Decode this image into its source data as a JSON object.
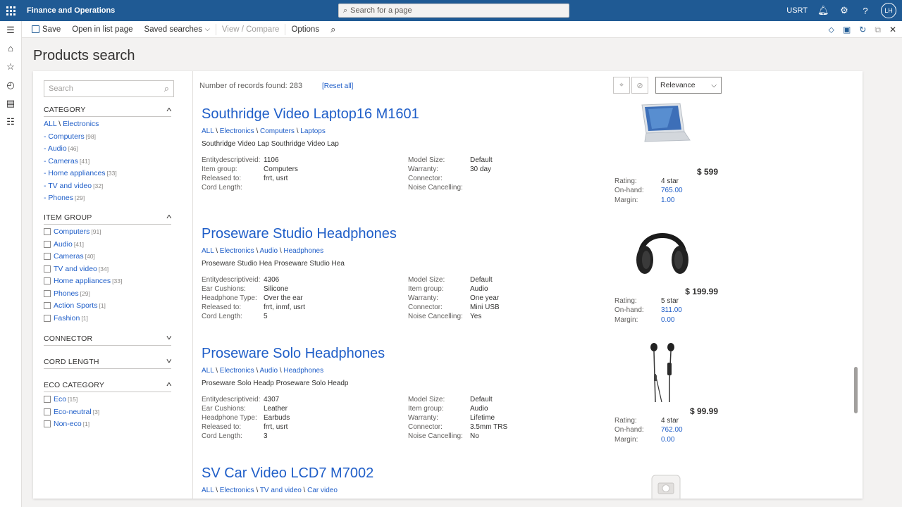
{
  "app": {
    "title": "Finance and Operations",
    "search_placeholder": "Search for a page",
    "company": "USRT",
    "user_initials": "LH"
  },
  "actions": {
    "save": "Save",
    "open_list": "Open in list page",
    "saved_searches": "Saved searches",
    "view_compare": "View / Compare",
    "options": "Options"
  },
  "page": {
    "title": "Products search"
  },
  "filters": {
    "search_placeholder": "Search",
    "category": {
      "title": "CATEGORY",
      "root_all": "ALL",
      "root_sep": " \\ ",
      "root_electronics": "Electronics",
      "items": [
        {
          "label": "- Computers",
          "count": "[98]"
        },
        {
          "label": "- Audio",
          "count": "[46]"
        },
        {
          "label": "- Cameras",
          "count": "[41]"
        },
        {
          "label": "- Home appliances",
          "count": "[33]"
        },
        {
          "label": "- TV and video",
          "count": "[32]"
        },
        {
          "label": "- Phones",
          "count": "[29]"
        }
      ]
    },
    "item_group": {
      "title": "ITEM GROUP",
      "items": [
        {
          "label": "Computers",
          "count": "[91]"
        },
        {
          "label": "Audio",
          "count": "[41]"
        },
        {
          "label": "Cameras",
          "count": "[40]"
        },
        {
          "label": "TV and video",
          "count": "[34]"
        },
        {
          "label": "Home appliances",
          "count": "[33]"
        },
        {
          "label": "Phones",
          "count": "[29]"
        },
        {
          "label": "Action Sports",
          "count": "[1]"
        },
        {
          "label": "Fashion",
          "count": "[1]"
        }
      ]
    },
    "connector": {
      "title": "CONNECTOR"
    },
    "cord_length": {
      "title": "CORD LENGTH"
    },
    "eco_category": {
      "title": "ECO CATEGORY",
      "items": [
        {
          "label": "Eco",
          "count": "[15]"
        },
        {
          "label": "Eco-neutral",
          "count": "[3]"
        },
        {
          "label": "Non-eco",
          "count": "[1]"
        }
      ]
    }
  },
  "results": {
    "count_text": "Number of records found: 283",
    "reset_all": "[Reset all]",
    "sort": "Relevance",
    "products": [
      {
        "title": "Southridge Video Laptop16 M1601",
        "crumbs": [
          "ALL",
          "Electronics",
          "Computers",
          "Laptops"
        ],
        "desc": "Southridge Video Lap Southridge Video Lap",
        "left_attrs": [
          [
            "Entitydescriptiveid:",
            "1106"
          ],
          [
            "Item group:",
            "Computers"
          ],
          [
            "Released to:",
            "frrt, usrt"
          ],
          [
            "Cord Length:",
            ""
          ]
        ],
        "right_attrs": [
          [
            "Model Size:",
            "Default"
          ],
          [
            "Warranty:",
            "30 day"
          ],
          [
            "Connector:",
            ""
          ],
          [
            "Noise Cancelling:",
            ""
          ]
        ],
        "price": "$ 599",
        "rating": "4 star",
        "onhand": "765.00",
        "margin": "1.00"
      },
      {
        "title": "Proseware Studio Headphones",
        "crumbs": [
          "ALL",
          "Electronics",
          "Audio",
          "Headphones"
        ],
        "desc": "Proseware Studio Hea Proseware Studio Hea",
        "left_attrs": [
          [
            "Entitydescriptiveid:",
            "4306"
          ],
          [
            "Ear Cushions:",
            "Silicone"
          ],
          [
            "Headphone Type:",
            "Over the ear"
          ],
          [
            "Released to:",
            "frrt, inmf, usrt"
          ],
          [
            "Cord Length:",
            "5"
          ]
        ],
        "right_attrs": [
          [
            "Model Size:",
            "Default"
          ],
          [
            "Item group:",
            "Audio"
          ],
          [
            "Warranty:",
            "One year"
          ],
          [
            "Connector:",
            "Mini USB"
          ],
          [
            "Noise Cancelling:",
            "Yes"
          ]
        ],
        "price": "$ 199.99",
        "rating": "5 star",
        "onhand": "311.00",
        "margin": "0.00"
      },
      {
        "title": "Proseware Solo Headphones",
        "crumbs": [
          "ALL",
          "Electronics",
          "Audio",
          "Headphones"
        ],
        "desc": "Proseware Solo Headp Proseware Solo Headp",
        "left_attrs": [
          [
            "Entitydescriptiveid:",
            "4307"
          ],
          [
            "Ear Cushions:",
            "Leather"
          ],
          [
            "Headphone Type:",
            "Earbuds"
          ],
          [
            "Released to:",
            "frrt, usrt"
          ],
          [
            "Cord Length:",
            "3"
          ]
        ],
        "right_attrs": [
          [
            "Model Size:",
            "Default"
          ],
          [
            "Item group:",
            "Audio"
          ],
          [
            "Warranty:",
            "Lifetime"
          ],
          [
            "Connector:",
            "3.5mm TRS"
          ],
          [
            "Noise Cancelling:",
            "No"
          ]
        ],
        "price": "$ 99.99",
        "rating": "4 star",
        "onhand": "762.00",
        "margin": "0.00"
      },
      {
        "title": "SV Car Video LCD7 M7002",
        "crumbs": [
          "ALL",
          "Electronics",
          "TV and video",
          "Car video"
        ]
      }
    ],
    "labels": {
      "rating": "Rating:",
      "onhand": "On-hand:",
      "margin": "Margin:"
    }
  },
  "icons": [
    "waffle-icon",
    "search-icon",
    "bell-icon",
    "gear-icon",
    "help-icon",
    "hamburger-icon",
    "home-icon",
    "star-icon",
    "clock-icon",
    "workspace-icon",
    "list-icon",
    "pin-icon",
    "unpin-icon",
    "chevron-down-icon",
    "chevron-up-icon"
  ],
  "colors": {
    "nav": "#1f5a94",
    "link": "#1f5ec8"
  }
}
